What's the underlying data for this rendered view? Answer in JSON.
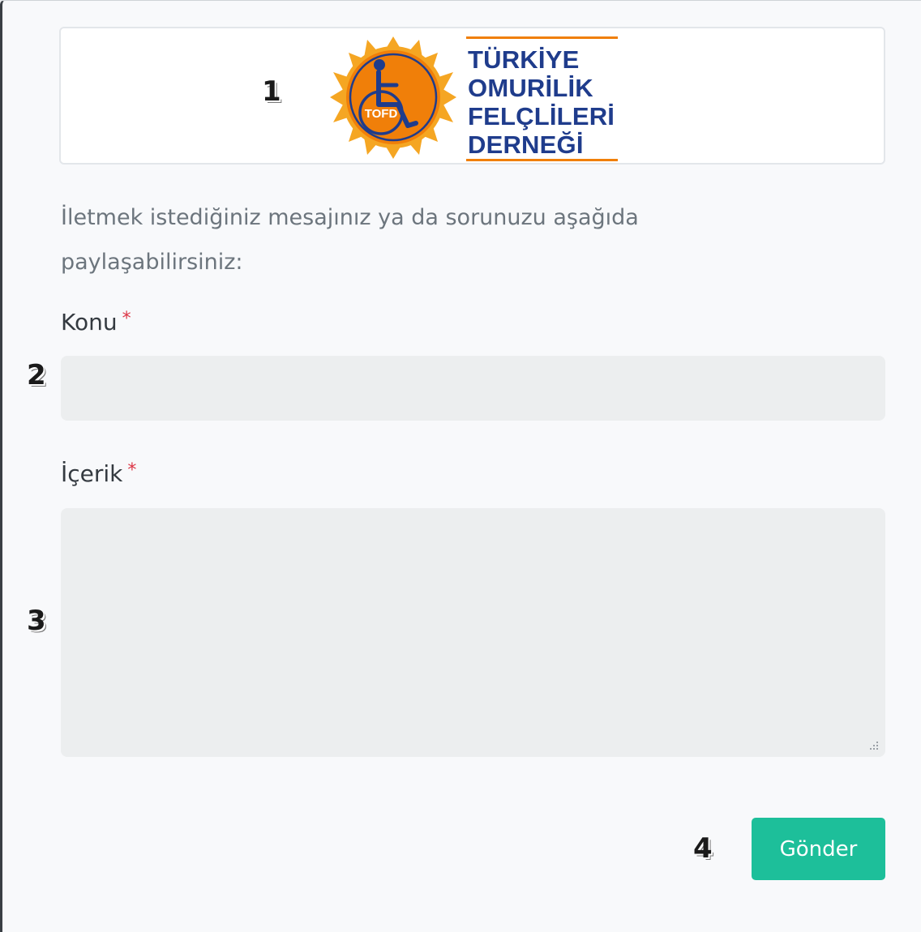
{
  "markers": [
    "1",
    "2",
    "3",
    "4"
  ],
  "logo": {
    "emblem_text": "TOFD",
    "name_lines": [
      "TÜRKİYE",
      "OMURİLİK",
      "FELÇLİLERİ",
      "DERNEĞİ"
    ],
    "colors": {
      "orange": "#f07f09",
      "blue": "#1f3c8c"
    }
  },
  "intro_text": "İletmek istediğiniz mesajınız ya da sorunuzu aşağıda paylaşabilirsiniz:",
  "form": {
    "subject": {
      "label": "Konu",
      "required_mark": "*",
      "value": ""
    },
    "content": {
      "label": "İçerik",
      "required_mark": "*",
      "value": ""
    },
    "submit_label": "Gönder"
  },
  "colors": {
    "submit": "#1dbf9a",
    "required": "#dc3545"
  }
}
